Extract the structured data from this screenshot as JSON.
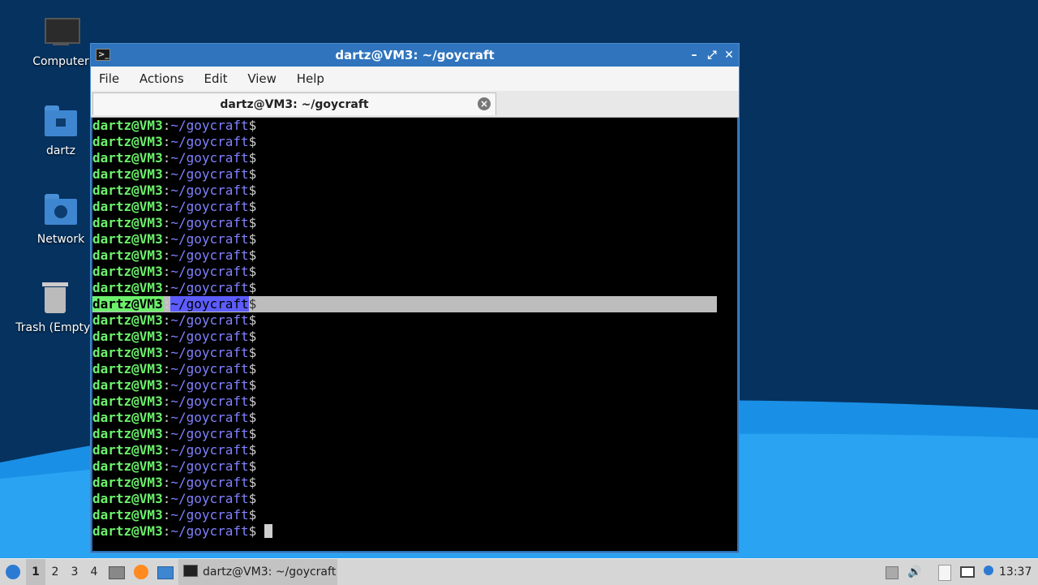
{
  "desktop": {
    "icons": [
      {
        "label": "Computer",
        "icon": "computer-icon"
      },
      {
        "label": "dartz",
        "icon": "home-folder-icon"
      },
      {
        "label": "Network",
        "icon": "network-folder-icon"
      },
      {
        "label": "Trash (Empty)",
        "icon": "trash-icon"
      }
    ]
  },
  "window": {
    "title": "dartz@VM3: ~/goycraft",
    "menu": [
      "File",
      "Actions",
      "Edit",
      "View",
      "Help"
    ],
    "tab_label": "dartz@VM3: ~/goycraft",
    "controls": {
      "minimize": "–",
      "maximize": "⤢",
      "close": "✕"
    }
  },
  "terminal": {
    "prompt_user": "dartz@VM3",
    "prompt_sep": ":",
    "prompt_path": "~/goycraft",
    "prompt_symbol": "$",
    "line_count": 26,
    "selected_line_index": 11
  },
  "taskbar": {
    "workspaces": [
      "1",
      "2",
      "3",
      "4"
    ],
    "active_workspace": "1",
    "task_label": "dartz@VM3: ~/goycraft",
    "clock": "13:37"
  }
}
